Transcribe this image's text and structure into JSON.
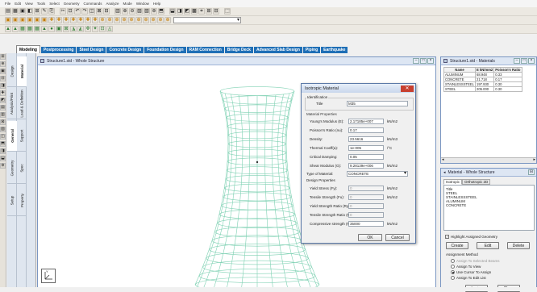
{
  "menu": [
    "File",
    "Edit",
    "View",
    "Tools",
    "Select",
    "Geometry",
    "Commands",
    "Analyze",
    "Mode",
    "Window",
    "Help"
  ],
  "toolbar": {
    "dropdown_value": ""
  },
  "tabs": [
    {
      "label": "Modeling",
      "active": true
    },
    {
      "label": "Postprocessing"
    },
    {
      "label": "Steel Design"
    },
    {
      "label": "Concrete Design"
    },
    {
      "label": "Foundation Design"
    },
    {
      "label": "RAM Connection"
    },
    {
      "label": "Bridge Deck"
    },
    {
      "label": "Advanced Slab Design"
    },
    {
      "label": "Piping"
    },
    {
      "label": "Earthquake"
    }
  ],
  "vtabs": {
    "outer": [
      "Design",
      "Analysis/Print",
      "General",
      "Geometry",
      "Setup"
    ],
    "middle": [
      "Material",
      "Load & Definition",
      "Support",
      "Spec",
      "Property"
    ]
  },
  "main_window": {
    "title": "Structure1.std - Whole Structure",
    "axis_label": "Y"
  },
  "dialog": {
    "title": "Isotropic Material",
    "identification_label": "Identification",
    "title_label": "Title",
    "title_value": "M35",
    "props_label": "Material Properties",
    "fields": [
      {
        "label": "Young's Modulus (E):",
        "value": "2.17185e+007",
        "unit": "kN/m2"
      },
      {
        "label": "Poisson's Ratio (nu):",
        "value": "0.17",
        "unit": ""
      },
      {
        "label": "Density:",
        "value": "23.5616",
        "unit": "kN/m3"
      },
      {
        "label": "Thermal Coeff(a):",
        "value": "1e-005",
        "unit": "/°C"
      },
      {
        "label": "Critical Damping:",
        "value": "0.05",
        "unit": ""
      },
      {
        "label": "Shear Modulus (G):",
        "value": "9.28139e+006",
        "unit": "kN/m2"
      }
    ],
    "type_label": "Type of Material:",
    "type_value": "CONCRETE",
    "design_label": "Design Properties",
    "design_fields": [
      {
        "label": "Yield Stress (Fy):",
        "value": "0",
        "unit": "kN/m2",
        "disabled": true
      },
      {
        "label": "Tensile Strength (Fu):",
        "value": "0",
        "unit": "kN/m2",
        "disabled": true
      },
      {
        "label": "Yield Strength Ratio (Ry):",
        "value": "0",
        "unit": "",
        "disabled": true
      },
      {
        "label": "Tensile Strength Ratio (Rt):",
        "value": "0",
        "unit": "",
        "disabled": true
      },
      {
        "label": "Compressive strength (Fcu):",
        "value": "35000",
        "unit": "kN/m2",
        "disabled": false
      }
    ],
    "ok": "OK",
    "cancel": "Cancel"
  },
  "materials_window": {
    "title": "Structure1.std - Materials",
    "headers": [
      "Name",
      "E kN/mm2",
      "Poisson's Ratio"
    ],
    "rows": [
      [
        "ALUMINUM",
        "68.948",
        "0.33"
      ],
      [
        "CONCRETE",
        "21.718",
        "0.17"
      ],
      [
        "STAINLESSSTEEL",
        "197.930",
        "0.30"
      ],
      [
        "STEEL",
        "205.000",
        "0.30"
      ]
    ]
  },
  "property_window": {
    "title": "Material - Whole Structure",
    "tabs": [
      "Isotropic",
      "Orthotropic 2D"
    ],
    "list_title": "Title",
    "list": [
      "STEEL",
      "STAINLESSSTEEL",
      "ALUMINUM",
      "CONCRETE"
    ],
    "highlight_label": "Highlight Assigned Geometry",
    "buttons": [
      "Create",
      "Edit",
      "Delete"
    ],
    "assign_label": "Assignment Method",
    "assign_options": [
      {
        "label": "Assign To Selected Beams",
        "selected": false,
        "disabled": true
      },
      {
        "label": "Assign To View",
        "selected": false
      },
      {
        "label": "Use Cursor To Assign",
        "selected": true
      },
      {
        "label": "Assign To Edit List",
        "selected": false
      }
    ],
    "assign_btn": "Assign",
    "close_btn": "Close"
  }
}
